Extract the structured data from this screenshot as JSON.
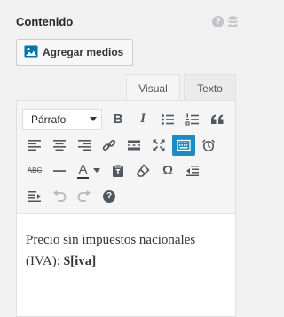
{
  "section": {
    "title": "Contenido"
  },
  "header_icons": [
    "help-icon",
    "database-icon"
  ],
  "media_button": {
    "label": "Agregar medios",
    "icon": "media-icon"
  },
  "tabs": [
    {
      "label": "Visual"
    },
    {
      "label": "Texto"
    }
  ],
  "toolbar": {
    "format_select": {
      "value": "Párrafo"
    },
    "row1": [
      "bold",
      "italic",
      "bullet-list",
      "numbered-list",
      "blockquote"
    ],
    "row2": [
      "align-left",
      "align-center",
      "align-right",
      "link",
      "read-more",
      "fullscreen",
      "toolbar-toggle (active)",
      "clock"
    ],
    "row3": [
      "strikethrough",
      "horizontal-line",
      "text-color",
      "paste-text",
      "clear-formatting",
      "special-character",
      "outdent"
    ],
    "row4": [
      "indent",
      "undo (disabled)",
      "redo (disabled)",
      "help"
    ],
    "strike_glyph": "ABC",
    "bold_glyph": "B",
    "italic_glyph": "I",
    "color_glyph": "A",
    "omega_glyph": "Ω",
    "help_glyph": "?"
  },
  "content": {
    "text": "Precio sin impuestos nacionales (IVA): ",
    "bold_text": "$[iva]"
  },
  "colors": {
    "accent": "#1e8cbe",
    "icon": "#50575e",
    "disabled": "#b4b9be"
  }
}
